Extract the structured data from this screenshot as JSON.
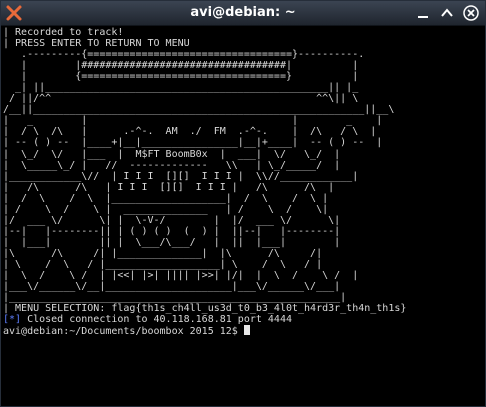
{
  "window": {
    "title": "avi@debian: ~",
    "accent": "#5f7fff",
    "icons": [
      "app-x-icon",
      "minimize-icon",
      "maximize-icon",
      "close-icon"
    ]
  },
  "terminal": {
    "lines": [
      "| Recorded to track!",
      "| PRESS ENTER TO RETURN TO MENU",
      "   .---------{==================================}----------.",
      "   |        |##################################|          |",
      "   |        {==================================}          |",
      "  _| ||_______________________________________________|| |_",
      " / ||/^^                                            ^^\\|| \\",
      "/__||_______________________________________________________||__\\",
      "|   _        |                                  |        _    |",
      "|  / \\  /\\   |      .-^-.  AM  ./  FM  .-^-.    |  /\\   / \\  |",
      "| -- ( ) --  |____+|__|________________|__|+____|  -- ( ) --  |",
      "|  \\_/  \\/   |___  |  M$FT BoomB0x  |  ___|  \\/   \\_/  |",
      "|  \\_____\\_/ |   //  -------------   \\\\   | \\_/_____/  |",
      "|____________\\//  | I I I  [][]  I I I |  \\\\//____________|",
      "|   /\\      /\\   | I I I  [][]  I I I |   /\\      /\\  |",
      "|  /  \\    /  \\  |___________________|  /  \\    /  \\ |",
      "| /    \\  /    \\ |  ______________   | /    \\  /    \\|",
      "|/  ___ \\/      \\| |  \\-V-/        |  |/  ___ \\/      \\|",
      "|--|   |--------|| | ( ) ( )  (  ) |  ||--|   |--------|",
      "|  |___|        || |  \\___/\\___/   |  ||  |___|        |",
      "|\\      /\\     /| |______________|  |\\      /\\     /|",
      "| \\    /  \\   / |___________________| \\    /  \\   / |",
      "|  \\  /    \\ /  | |<<| |>| |||| |>>| |/|  |  \\  /    \\ /  |",
      "|___\\/______\\/__|_____________________|___\\/______\\/___|",
      "|_______________________________________________________|",
      "| MENU SELECTION: flag{th1s_ch4ll_us3d_t0_b3_4l0t_h4rd3r_th4n_th1s}"
    ],
    "closed_line": {
      "tag": "[*]",
      "message": " Closed connection to 40.118.168.81 port 4444"
    },
    "prompt": "avi@debian:~/Documents/boombox_2015_12$ "
  }
}
